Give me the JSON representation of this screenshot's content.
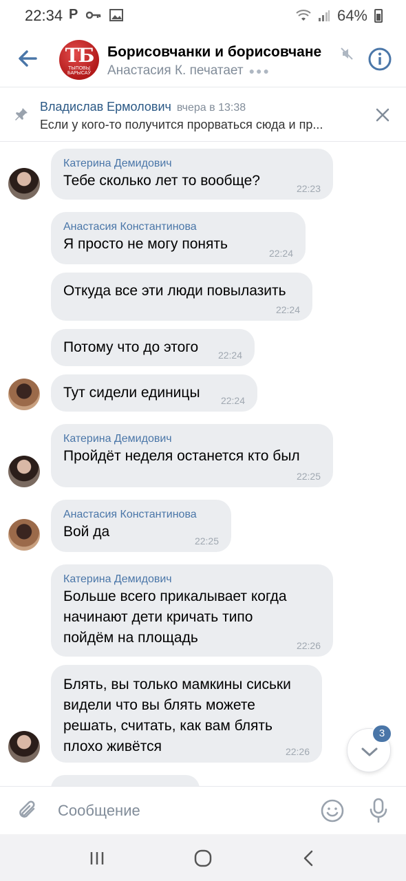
{
  "status_bar": {
    "time": "22:34",
    "battery": "64%",
    "icons": [
      "p-icon",
      "key-icon",
      "image-icon",
      "wifi-icon",
      "signal-icon",
      "battery-icon"
    ]
  },
  "header": {
    "title": "Борисовчанки и борисовчане",
    "status": "Анастасия К. печатает",
    "avatar_text": "ТБ",
    "avatar_subtext": "ТЫПОВЫ\nБАРЫСАЎ",
    "accent": "#4a76a8"
  },
  "pinned": {
    "author": "Владислав Ермолович",
    "time": "вчера в 13:38",
    "text": "Если у кого-то получится прорваться сюда и пр..."
  },
  "messages": [
    {
      "sender": "Катерина Демидович",
      "text": "Тебе сколько лет то вообще?",
      "time": "22:23"
    },
    {
      "sender": "Анастасия Константинова",
      "text": "Я просто не могу понять",
      "time": "22:24"
    },
    {
      "sender": "",
      "text": "Откуда все эти люди повылазить",
      "time": "22:24"
    },
    {
      "sender": "",
      "text": "Потому что до этого",
      "time": "22:24"
    },
    {
      "sender": "",
      "text": "Тут сидели единицы",
      "time": "22:24"
    },
    {
      "sender": "Катерина Демидович",
      "text": "Пройдёт неделя останется кто был",
      "time": "22:25"
    },
    {
      "sender": "Анастасия Константинова",
      "text": "Вой да",
      "time": "22:25"
    },
    {
      "sender": "Катерина Демидович",
      "text": "Больше всего прикалывает когда начинают дети кричать типо пойдём на площадь",
      "time": "22:26"
    },
    {
      "sender": "",
      "text": "Блять, вы только мамкины сиськи видели что вы блять можете решать, считать, как вам блять плохо живётся",
      "time": "22:26"
    }
  ],
  "scroll_badge": "3",
  "composer": {
    "placeholder": "Сообщение"
  }
}
